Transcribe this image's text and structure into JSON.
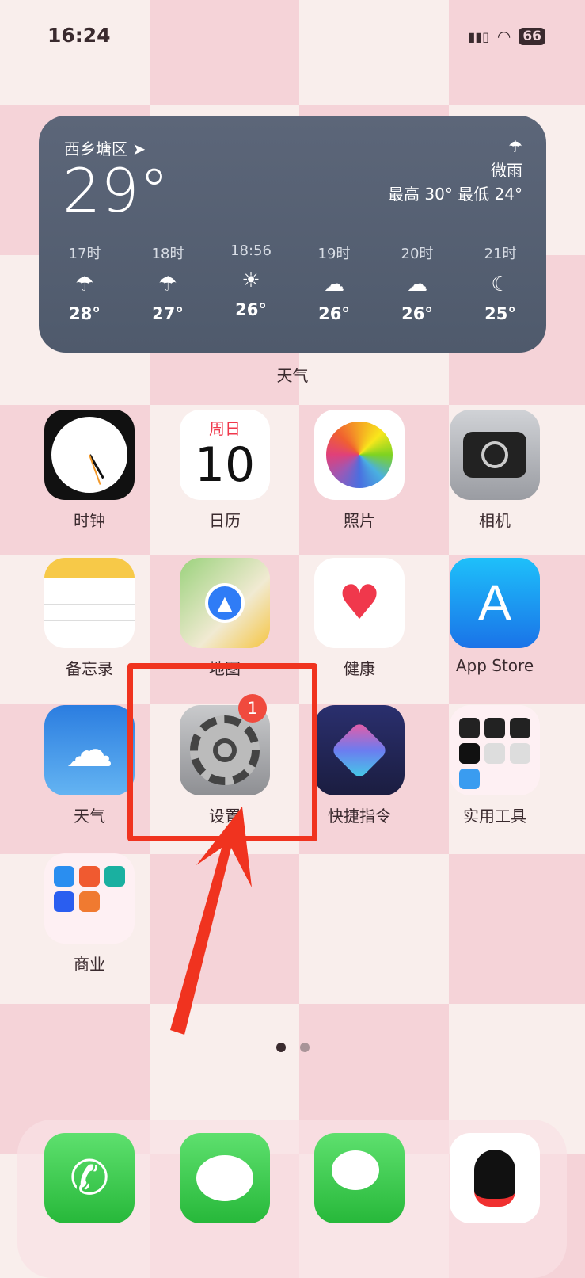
{
  "status": {
    "time": "16:24",
    "battery": "66",
    "icons": [
      "signal-icon",
      "wifi-icon",
      "battery-icon"
    ]
  },
  "weather_widget": {
    "location": "西乡塘区",
    "temperature": "29°",
    "condition": "微雨",
    "high_low": "最高 30° 最低 24°",
    "hours": [
      {
        "time": "17时",
        "icon": "rain-icon",
        "temp": "28°"
      },
      {
        "time": "18时",
        "icon": "rain-icon",
        "temp": "27°"
      },
      {
        "time": "18:56",
        "icon": "sunset-icon",
        "temp": "26°"
      },
      {
        "time": "19时",
        "icon": "cloud-icon",
        "temp": "26°"
      },
      {
        "time": "20时",
        "icon": "cloud-icon",
        "temp": "26°"
      },
      {
        "time": "21时",
        "icon": "cloud-moon-icon",
        "temp": "25°"
      }
    ],
    "label": "天气"
  },
  "apps": [
    {
      "label": "时钟",
      "name": "clock"
    },
    {
      "label": "日历",
      "name": "calendar",
      "weekday": "周日",
      "day": "10"
    },
    {
      "label": "照片",
      "name": "photos"
    },
    {
      "label": "相机",
      "name": "camera"
    },
    {
      "label": "备忘录",
      "name": "notes"
    },
    {
      "label": "地图",
      "name": "maps"
    },
    {
      "label": "健康",
      "name": "health"
    },
    {
      "label": "App Store",
      "name": "app-store"
    },
    {
      "label": "天气",
      "name": "weather"
    },
    {
      "label": "设置",
      "name": "settings",
      "badge": "1"
    },
    {
      "label": "快捷指令",
      "name": "shortcuts"
    },
    {
      "label": "实用工具",
      "name": "utilities-folder"
    },
    {
      "label": "商业",
      "name": "business-folder"
    }
  ],
  "dock": [
    {
      "name": "phone"
    },
    {
      "name": "messages"
    },
    {
      "name": "wechat"
    },
    {
      "name": "qq"
    }
  ],
  "annotation": {
    "color": "#f0331f"
  },
  "page_indicator": {
    "pages": 2,
    "current": 1
  }
}
